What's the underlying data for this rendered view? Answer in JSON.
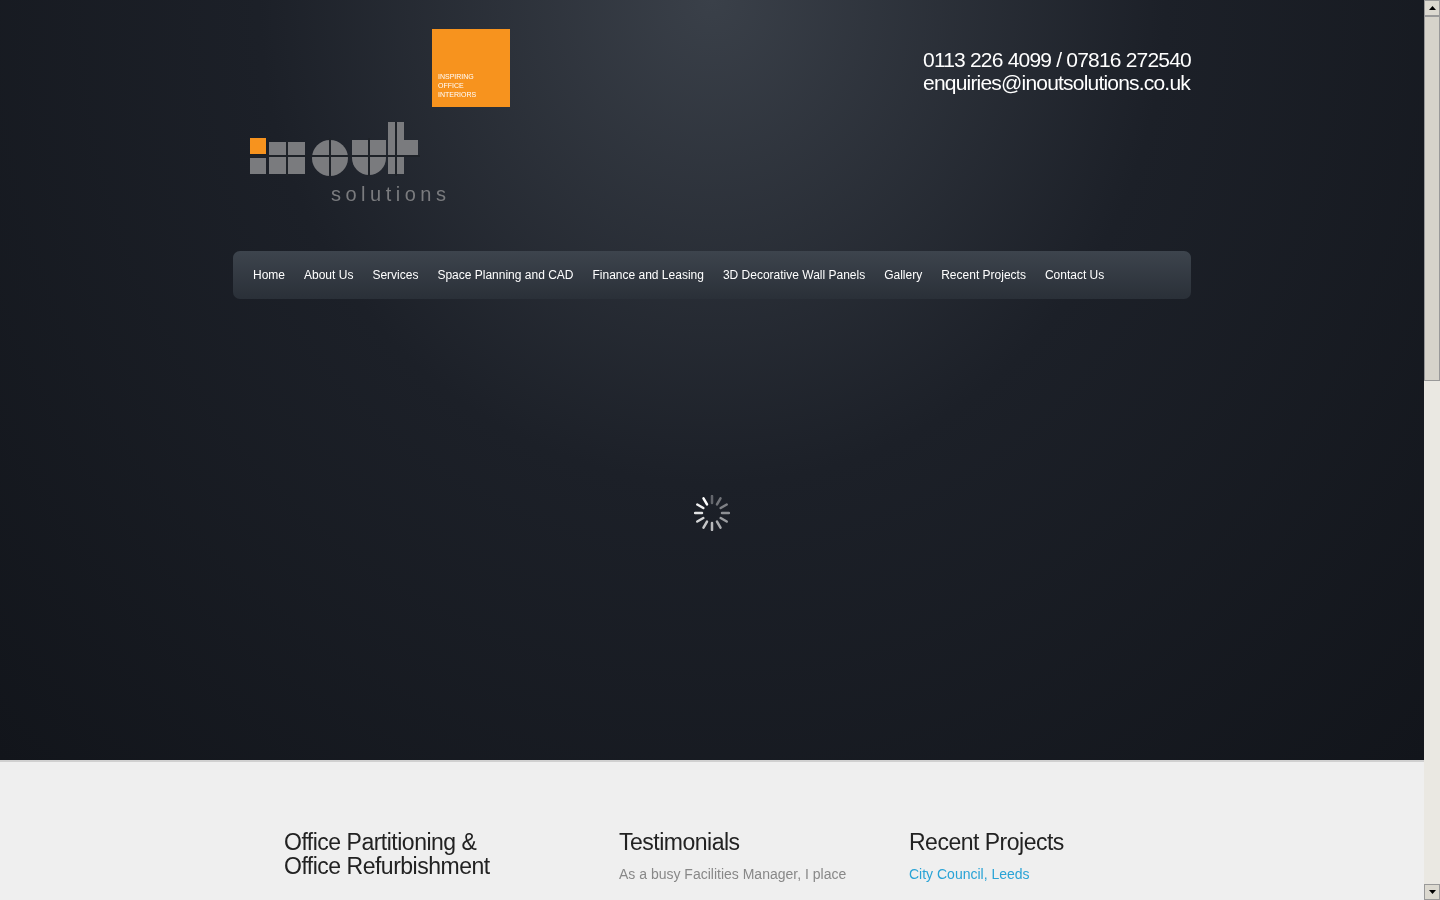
{
  "logo": {
    "tagline_lines": [
      "INSPIRING",
      "OFFICE",
      "INTERIORS"
    ],
    "wordmark": "solutions"
  },
  "contact": {
    "phone": "0113 226 4099 / 07816 272540",
    "email": "enquiries@inoutsolutions.co.uk"
  },
  "nav": [
    {
      "label": "Home"
    },
    {
      "label": "About Us"
    },
    {
      "label": "Services"
    },
    {
      "label": "Space Planning and CAD"
    },
    {
      "label": "Finance and Leasing"
    },
    {
      "label": "3D Decorative Wall Panels"
    },
    {
      "label": "Gallery"
    },
    {
      "label": "Recent Projects"
    },
    {
      "label": "Contact Us"
    }
  ],
  "columns": [
    {
      "kind": "text",
      "title_lines": [
        "Office Partitioning &",
        "Office Refurbishment"
      ]
    },
    {
      "kind": "text",
      "title_lines": [
        "Testimonials"
      ],
      "body": "As a busy Facilities Manager, I place"
    },
    {
      "kind": "links",
      "title_lines": [
        "Recent Projects"
      ],
      "links": [
        "City Council, Leeds"
      ]
    }
  ]
}
